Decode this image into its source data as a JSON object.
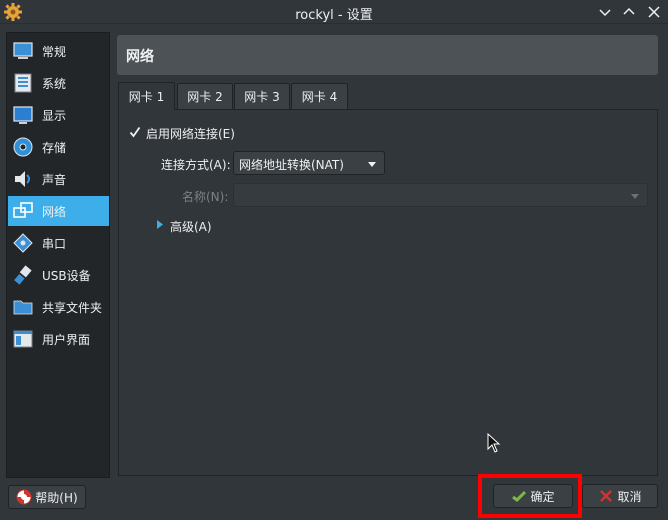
{
  "window": {
    "title": "rockyl - 设置"
  },
  "sidebar": {
    "items": [
      {
        "label": "常规",
        "icon": "general-icon"
      },
      {
        "label": "系统",
        "icon": "system-icon"
      },
      {
        "label": "显示",
        "icon": "display-icon"
      },
      {
        "label": "存储",
        "icon": "storage-icon"
      },
      {
        "label": "声音",
        "icon": "audio-icon"
      },
      {
        "label": "网络",
        "icon": "network-icon",
        "active": true
      },
      {
        "label": "串口",
        "icon": "serial-port-icon"
      },
      {
        "label": "USB设备",
        "icon": "usb-icon"
      },
      {
        "label": "共享文件夹",
        "icon": "shared-folder-icon"
      },
      {
        "label": "用户界面",
        "icon": "user-interface-icon"
      }
    ]
  },
  "main": {
    "header_title": "网络",
    "tabs": [
      {
        "label": "网卡 1",
        "active": true
      },
      {
        "label": "网卡 2"
      },
      {
        "label": "网卡 3"
      },
      {
        "label": "网卡 4"
      }
    ],
    "enable_adapter": {
      "label": "启用网络连接(E)",
      "checked": true
    },
    "attached_to": {
      "label": "连接方式(A):",
      "value": "网络地址转换(NAT)"
    },
    "name": {
      "label": "名称(N):",
      "value": ""
    },
    "advanced": {
      "label": "高级(A)"
    }
  },
  "footer": {
    "help_label": "帮助(H)",
    "ok_label": "确定",
    "cancel_label": "取消"
  },
  "colors": {
    "accent": "#3daee9",
    "highlight_box": "#ff0000",
    "background": "#31363b"
  }
}
